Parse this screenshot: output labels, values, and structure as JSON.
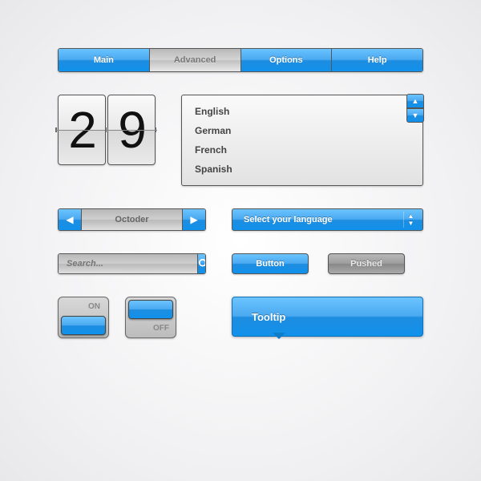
{
  "tabs": {
    "items": [
      "Main",
      "Advanced",
      "Options",
      "Help"
    ],
    "active_index": 1
  },
  "flip": {
    "digit1": "2",
    "digit2": "9"
  },
  "listbox": {
    "items": [
      "English",
      "German",
      "French",
      "Spanish"
    ]
  },
  "spinner": {
    "label": "Octoder"
  },
  "select": {
    "label": "Select your language"
  },
  "search": {
    "placeholder": "Search..."
  },
  "buttons": {
    "primary": "Button",
    "secondary": "Pushed"
  },
  "toggle": {
    "on_label": "ON",
    "off_label": "OFF"
  },
  "tooltip": {
    "text": "Tooltip"
  }
}
